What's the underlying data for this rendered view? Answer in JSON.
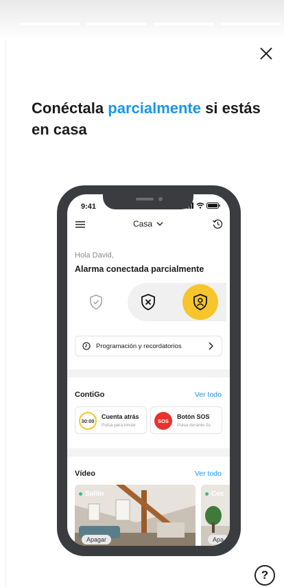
{
  "onboarding": {
    "progress_segments": 4,
    "current_segment": 1,
    "headline_before": "Conéctala ",
    "headline_highlight": "parcialmente",
    "headline_after": " si estás en casa",
    "help_label": "?"
  },
  "phone": {
    "status_time": "9:41",
    "header": {
      "location": "Casa"
    },
    "greeting": "Hola David,",
    "alarm_state": "Alarma conectada parcialmente",
    "modes": [
      "desconectada",
      "total",
      "parcial"
    ],
    "active_mode": "parcial",
    "schedule_label": "Programación y recordatorios",
    "contigo": {
      "title": "ContiGo",
      "see_all": "Ver todo",
      "cards": [
        {
          "badge": "30:00",
          "title": "Cuenta atrás",
          "subtitle": "Pulsa para iniciar"
        },
        {
          "badge": "SOS",
          "title": "Botón SOS",
          "subtitle": "Pulsa durante 2s"
        }
      ]
    },
    "video": {
      "title": "Vídeo",
      "see_all": "Ver todo",
      "cameras": [
        {
          "name": "Salón",
          "action": "Apagar"
        },
        {
          "name": "Coc",
          "action": "Apa"
        }
      ]
    }
  },
  "colors": {
    "accent_blue": "#1797e6",
    "partial_yellow": "#f6c52b",
    "sos_red": "#e8322e",
    "phone_frame": "#3a3c40"
  }
}
